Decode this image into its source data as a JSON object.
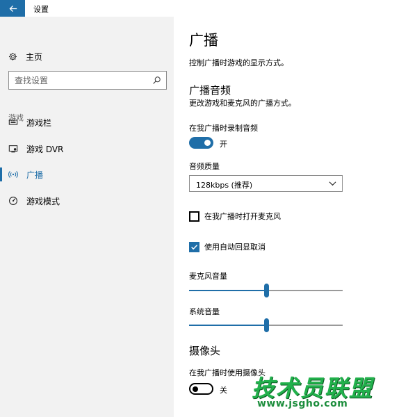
{
  "window": {
    "title": "设置"
  },
  "sidebar": {
    "home_label": "主页",
    "search": {
      "placeholder": "查找设置"
    },
    "section_label": "游戏",
    "items": [
      {
        "label": "游戏栏",
        "icon": "game-bar-icon"
      },
      {
        "label": "游戏 DVR",
        "icon": "game-dvr-icon"
      },
      {
        "label": "广播",
        "icon": "broadcast-icon",
        "active": true
      },
      {
        "label": "游戏模式",
        "icon": "game-mode-icon"
      }
    ]
  },
  "main": {
    "title": "广播",
    "description": "控制广播时游戏的显示方式。",
    "audio_section": {
      "title": "广播音频",
      "description": "更改游戏和麦克风的广播方式。",
      "record_audio": {
        "label": "在我广播时录制音频",
        "state": "开",
        "on": true
      },
      "audio_quality": {
        "label": "音频质量",
        "value": "128kbps (推荐)"
      },
      "mic_checkbox": {
        "label": "在我广播时打开麦克风",
        "checked": false
      },
      "echo_checkbox": {
        "label": "使用自动回显取消",
        "checked": true
      },
      "mic_volume": {
        "label": "麦克风音量",
        "value": 0.5
      },
      "system_volume": {
        "label": "系统音量",
        "value": 0.5
      }
    },
    "camera_section": {
      "title": "摄像头",
      "use_camera": {
        "label": "在我广播时使用摄像头",
        "state": "关",
        "on": false
      }
    }
  },
  "watermark": {
    "main": "技术员联盟",
    "url": "www.jsgho.com"
  },
  "colors": {
    "accent": "#1f6ea8",
    "sidebar_bg": "#f2f2f2"
  }
}
